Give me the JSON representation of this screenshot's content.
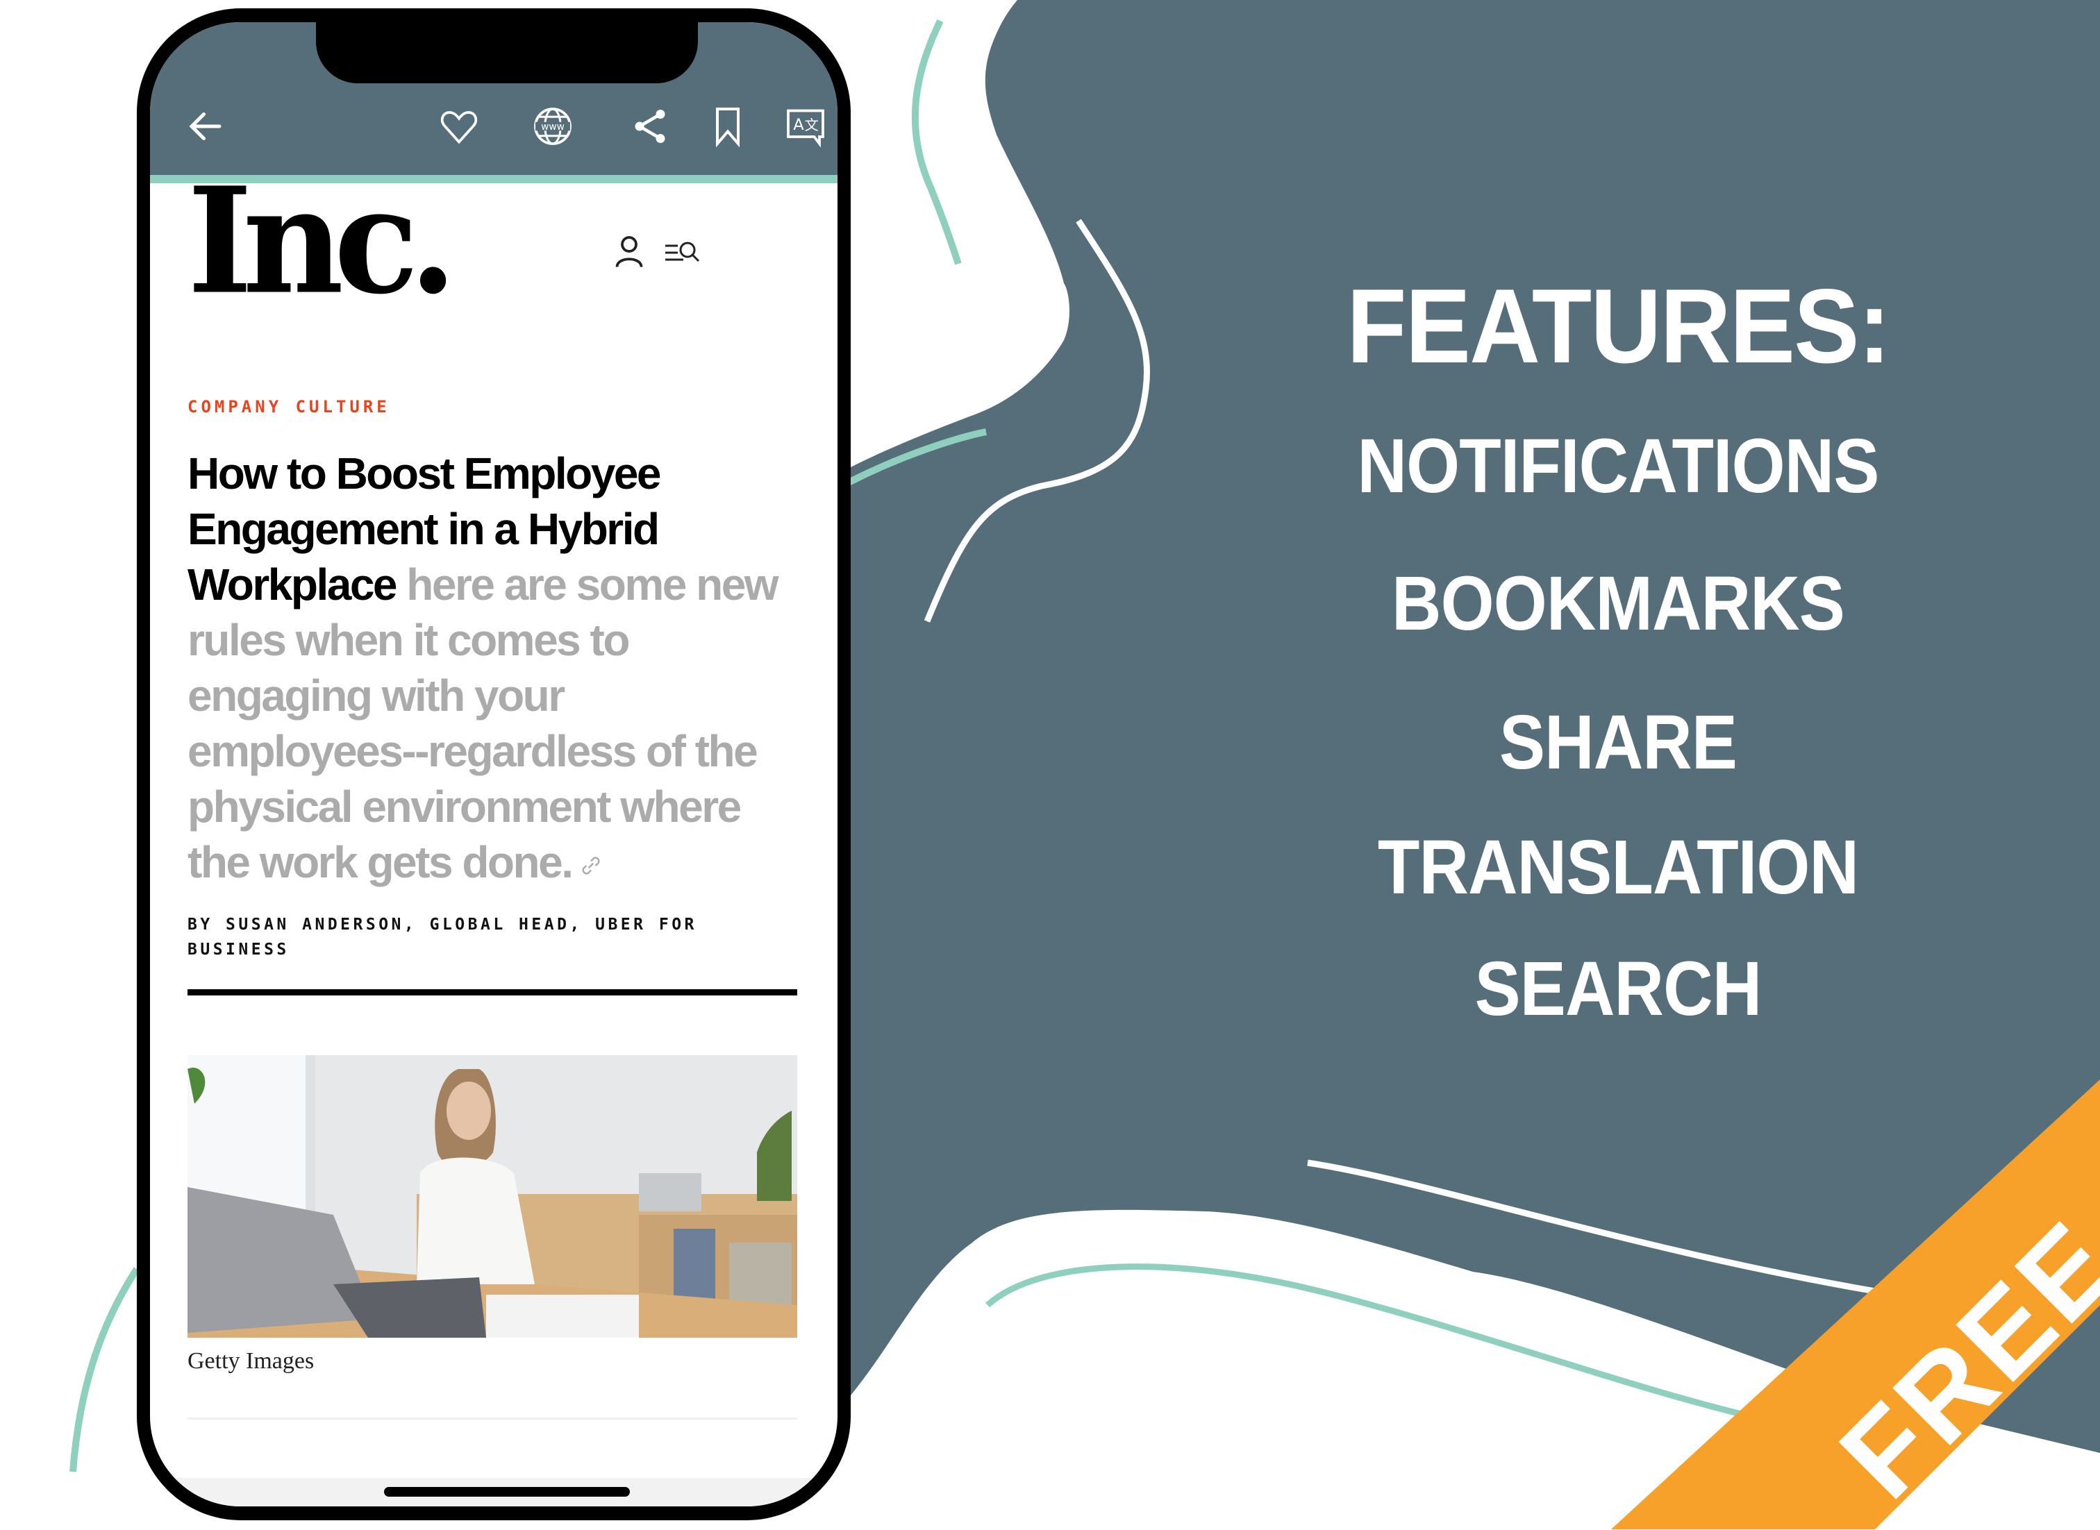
{
  "colors": {
    "brand_slate": "#566E7A",
    "accent_teal": "#8ECFBD",
    "accent_orange": "#F8A12A",
    "kicker_red": "#E8431C",
    "dek_grey": "#ABABAB"
  },
  "app_bar": {
    "icons": [
      "back-arrow-icon",
      "heart-icon",
      "www-globe-icon",
      "share-icon",
      "bookmark-icon",
      "translate-icon"
    ]
  },
  "site_header": {
    "logo_text": "Inc.",
    "icons": [
      "user-icon",
      "menu-search-icon"
    ]
  },
  "article": {
    "kicker": "COMPANY CULTURE",
    "headline": "How to Boost Employee Engagement in a Hybrid Workplace",
    "dek": "here are some new rules when it comes to engaging with your employees--regardless of the physical environment where the work gets done.",
    "dek_icon": "link-icon",
    "byline": "BY SUSAN ANDERSON, GLOBAL HEAD, UBER FOR BUSINESS",
    "image_alt": "Woman working at a laptop in a home office",
    "image_caption": "Getty Images"
  },
  "promo": {
    "title": "FEATURES:",
    "items": [
      "NOTIFICATIONS",
      "BOOKMARKS",
      "SHARE",
      "TRANSLATION",
      "SEARCH"
    ],
    "badge": "FREE"
  }
}
